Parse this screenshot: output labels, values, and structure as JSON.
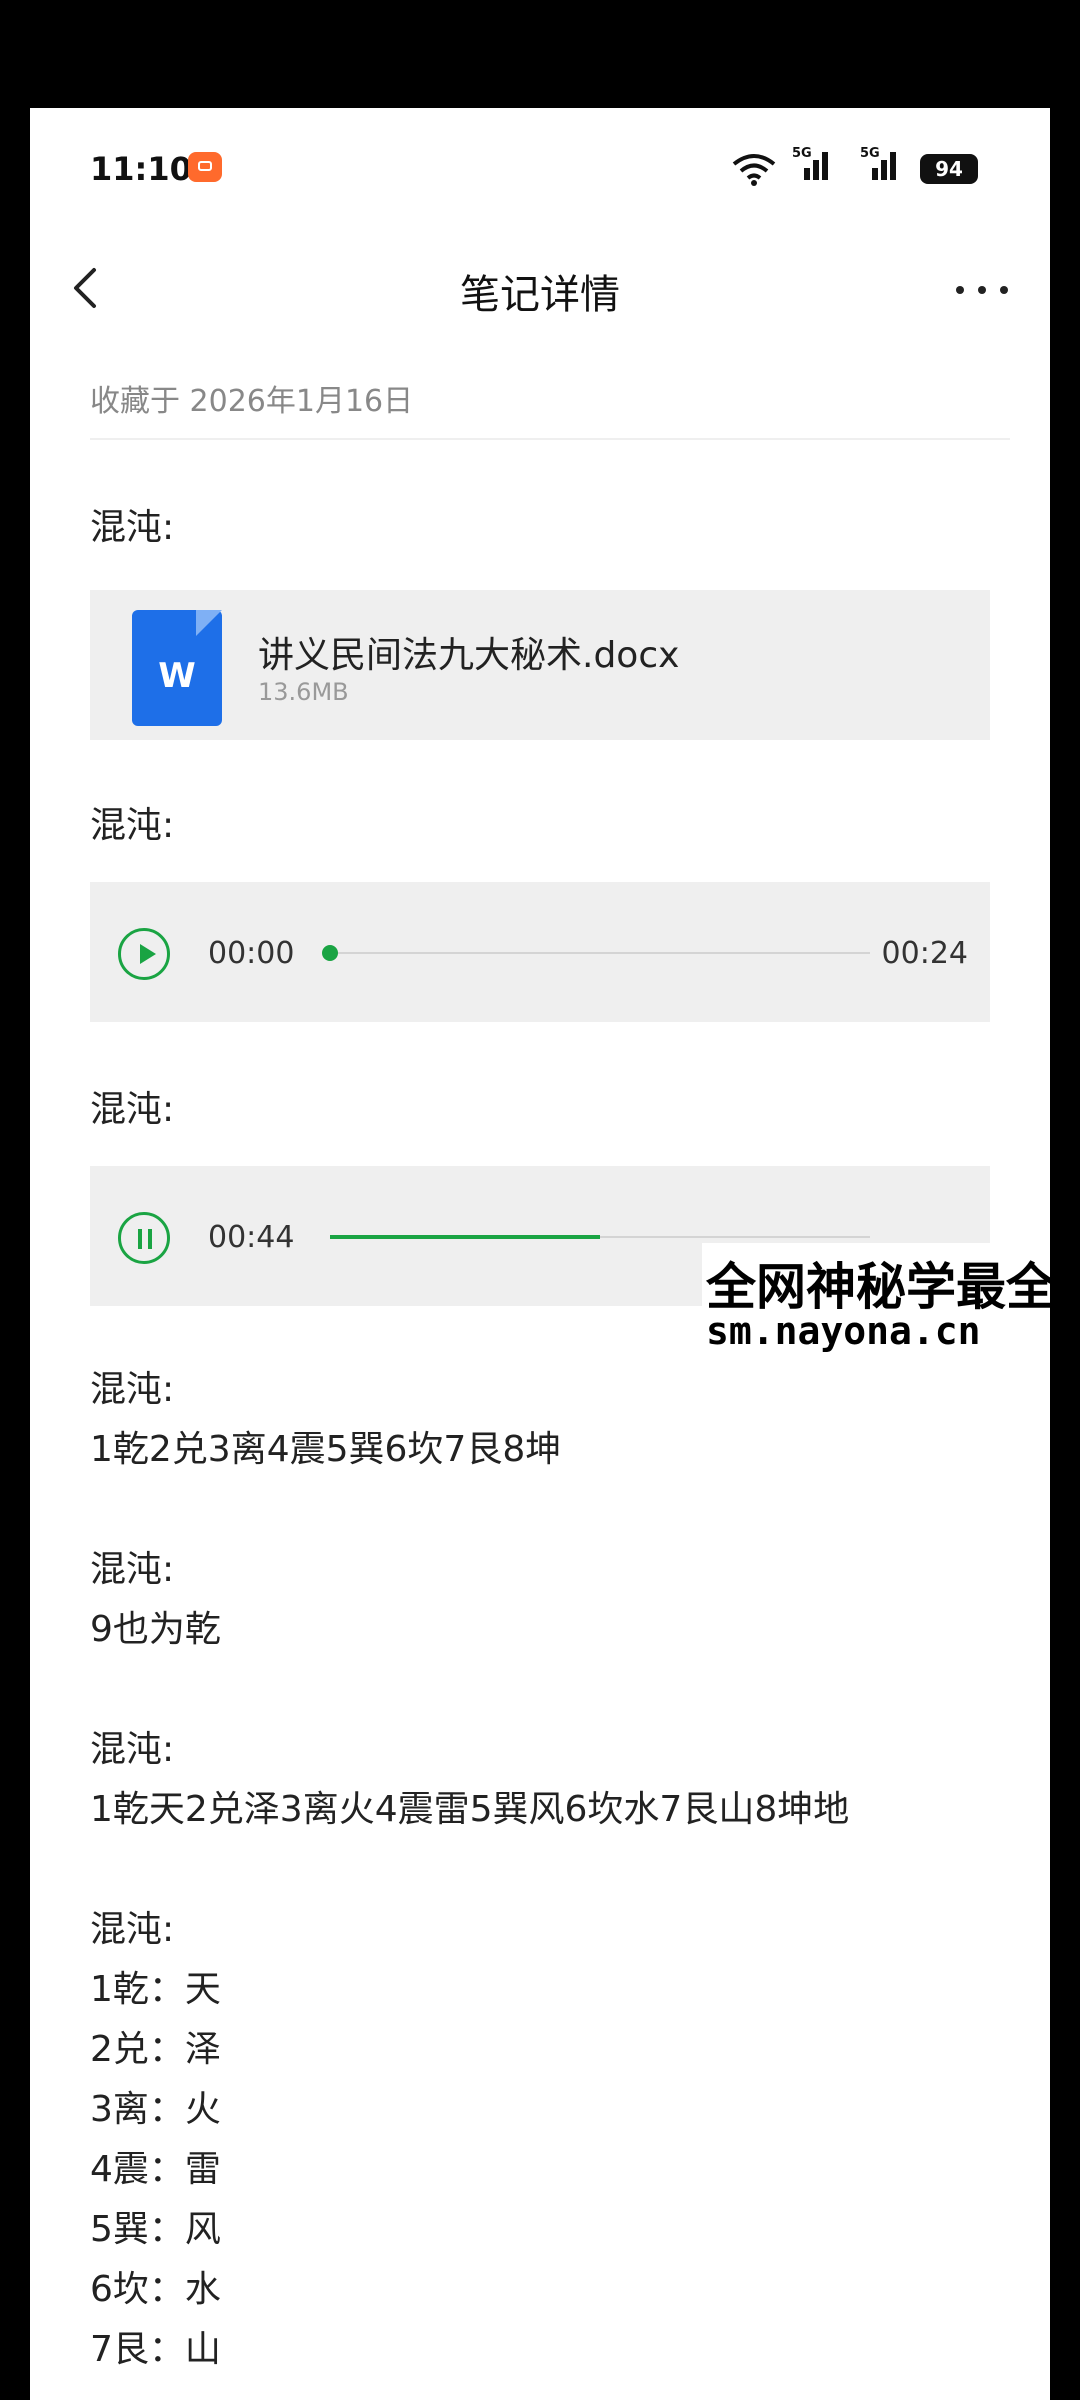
{
  "status_bar": {
    "time": "11:10",
    "net1": "5G",
    "net2": "5G",
    "battery": "94"
  },
  "header": {
    "title": "笔记详情"
  },
  "meta": {
    "saved_text": "收藏于 2026年1月16日"
  },
  "blocks": {
    "label1": "混沌:",
    "file": {
      "icon_letter": "W",
      "name": "讲义民间法九大秘术.docx",
      "size": "13.6MB"
    },
    "label2": "混沌:",
    "audio1": {
      "current": "00:00",
      "duration": "00:24",
      "progress": 0.0
    },
    "label3": "混沌:",
    "audio2": {
      "current": "00:44",
      "progress": 0.5
    },
    "note4": {
      "label": "混沌:",
      "lines": [
        "1乾2兑3离4震5巽6坎7艮8坤"
      ]
    },
    "note5": {
      "label": "混沌:",
      "lines": [
        "9也为乾"
      ]
    },
    "note6": {
      "label": "混沌:",
      "lines": [
        "1乾天2兑泽3离火4震雷5巽风6坎水7艮山8坤地"
      ]
    },
    "note7": {
      "label": "混沌:",
      "lines": [
        "1乾：天",
        "2兑：泽",
        "3离：火",
        "4震：雷",
        "5巽：风",
        "6坎：水",
        "7艮：山"
      ]
    }
  },
  "watermark": {
    "line1": "全网神秘学最全",
    "line2": "sm.nayona.cn"
  },
  "colors": {
    "accent": "#1aa443",
    "doc_blue": "#1e6fe8",
    "card_bg": "#efefef"
  }
}
